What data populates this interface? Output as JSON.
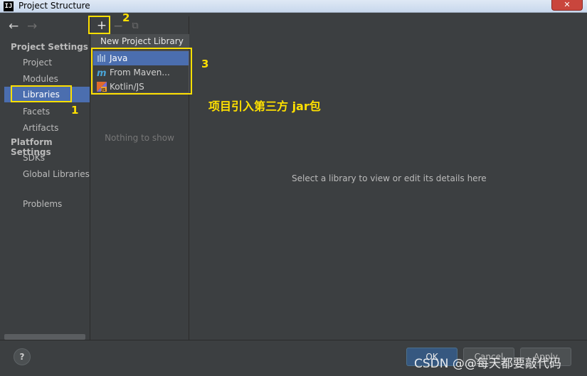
{
  "window": {
    "app_icon_text": "IJ",
    "title": "Project Structure",
    "close_label": "✕"
  },
  "nav": {
    "back_icon": "←",
    "forward_icon": "→",
    "project_settings_header": "Project Settings",
    "platform_settings_header": "Platform Settings",
    "items": {
      "project": "Project",
      "modules": "Modules",
      "libraries": "Libraries",
      "facets": "Facets",
      "artifacts": "Artifacts",
      "sdks": "SDKs",
      "global_libraries": "Global Libraries",
      "problems": "Problems"
    },
    "selected": "Libraries"
  },
  "toolbar": {
    "add_icon": "+",
    "remove_icon": "−",
    "copy_icon": "⧉"
  },
  "library_list": {
    "empty_text": "Nothing to show"
  },
  "popup": {
    "title": "New Project Library",
    "items": {
      "java": "Java",
      "maven": "From Maven...",
      "kotlin": "Kotlin/JS"
    },
    "selected": "Java"
  },
  "detail": {
    "placeholder": "Select a library to view or edit its details here"
  },
  "annotations": {
    "step1": "1",
    "step2": "2",
    "step3": "3",
    "note": "项目引入第三方 jar包",
    "color": "#ffe000"
  },
  "footer": {
    "help_label": "?",
    "ok_label": "OK",
    "cancel_label": "Cancel",
    "apply_label": "Apply"
  },
  "watermark": "CSDN @@每天都要敲代码",
  "colors": {
    "background": "#3c3f41",
    "selection": "#4b6eaf",
    "primary_button": "#365880"
  }
}
